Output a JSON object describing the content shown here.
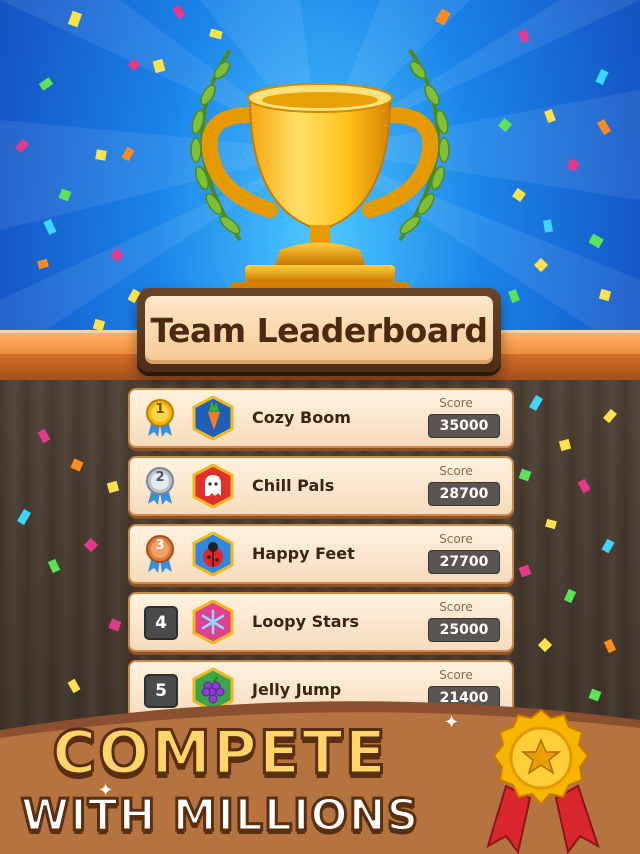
{
  "title": "Team Leaderboard",
  "score_label": "Score",
  "teams": [
    {
      "rank": "1",
      "name": "Cozy Boom",
      "score": "35000",
      "icon": "carrot-icon",
      "medal": "gold"
    },
    {
      "rank": "2",
      "name": "Chill Pals",
      "score": "28700",
      "icon": "ghost-icon",
      "medal": "silver"
    },
    {
      "rank": "3",
      "name": "Happy Feet",
      "score": "27700",
      "icon": "ladybug-icon",
      "medal": "bronze"
    },
    {
      "rank": "4",
      "name": "Loopy Stars",
      "score": "25000",
      "icon": "snowflake-icon",
      "medal": "none"
    },
    {
      "rank": "5",
      "name": "Jelly Jump",
      "score": "21400",
      "icon": "grapes-icon",
      "medal": "none"
    }
  ],
  "banner": {
    "line1": "COMPETE",
    "line2": "WITH MILLIONS"
  },
  "colors": {
    "sky": "#1b86ea",
    "wood": "#3a2f26",
    "gold": "#ffd56a",
    "row_bg": "#fff2e0"
  }
}
